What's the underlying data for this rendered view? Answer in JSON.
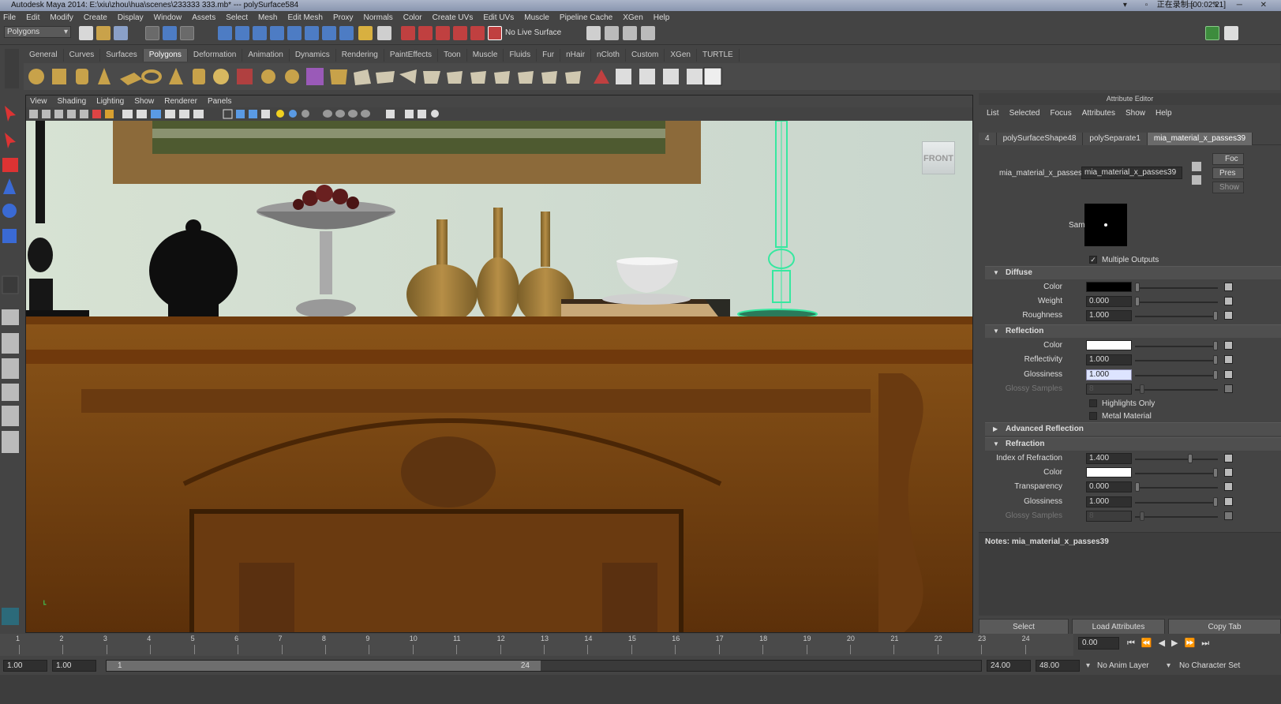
{
  "window": {
    "title": "Autodesk Maya 2014: E:\\xiu\\zhou\\hua\\scenes\\233333 333.mb*  ---  polySurface584",
    "recording": "正在录制 [00:02:21]"
  },
  "menubar": [
    "File",
    "Edit",
    "Modify",
    "Create",
    "Display",
    "Window",
    "Assets",
    "Select",
    "Mesh",
    "Edit Mesh",
    "Proxy",
    "Normals",
    "Color",
    "Create UVs",
    "Edit UVs",
    "Muscle",
    "Pipeline Cache",
    "XGen",
    "Help"
  ],
  "statusline": {
    "mode": "Polygons",
    "live_surface": "No Live Surface"
  },
  "shelf_tabs": [
    "General",
    "Curves",
    "Surfaces",
    "Polygons",
    "Deformation",
    "Animation",
    "Dynamics",
    "Rendering",
    "PaintEffects",
    "Toon",
    "Muscle",
    "Fluids",
    "Fur",
    "nHair",
    "nCloth",
    "Custom",
    "XGen",
    "TURTLE"
  ],
  "shelf_active": "Polygons",
  "viewport": {
    "menu": [
      "View",
      "Shading",
      "Lighting",
      "Show",
      "Renderer",
      "Panels"
    ],
    "view_cube": "FRONT"
  },
  "attribute_editor": {
    "title": "Attribute Editor",
    "menu": [
      "List",
      "Selected",
      "Focus",
      "Attributes",
      "Show",
      "Help"
    ],
    "tabs": [
      "4",
      "polySurfaceShape48",
      "polySeparate1",
      "mia_material_x_passes39"
    ],
    "active_tab": "mia_material_x_passes39",
    "node_label": "mia_material_x_passes:",
    "node_name": "mia_material_x_passes39",
    "side_buttons": [
      "Foc",
      "Pres",
      "Show"
    ],
    "sample_label": "Sample",
    "multiple_outputs": "Multiple Outputs",
    "diffuse": {
      "header": "Diffuse",
      "color_label": "Color",
      "color": "#000000",
      "weight_label": "Weight",
      "weight": "0.000",
      "roughness_label": "Roughness",
      "roughness": "1.000"
    },
    "reflection": {
      "header": "Reflection",
      "color_label": "Color",
      "color": "#ffffff",
      "reflectivity_label": "Reflectivity",
      "reflectivity": "1.000",
      "glossiness_label": "Glossiness",
      "glossiness": "1.000",
      "glossy_samples_label": "Glossy Samples",
      "glossy_samples": "8",
      "highlights_only": "Highlights Only",
      "metal_material": "Metal Material"
    },
    "advanced_reflection": {
      "header": "Advanced Reflection"
    },
    "refraction": {
      "header": "Refraction",
      "ior_label": "Index of Refraction",
      "ior": "1.400",
      "color_label": "Color",
      "color": "#ffffff",
      "transparency_label": "Transparency",
      "transparency": "0.000",
      "glossiness_label": "Glossiness",
      "glossiness": "1.000",
      "glossy_samples_label": "Glossy Samples",
      "glossy_samples": "8"
    },
    "notes": "Notes:  mia_material_x_passes39",
    "buttons": [
      "Select",
      "Load Attributes",
      "Copy Tab"
    ]
  },
  "timeslider": {
    "ticks": [
      "1",
      "2",
      "3",
      "4",
      "5",
      "6",
      "7",
      "8",
      "9",
      "10",
      "11",
      "12",
      "13",
      "14",
      "15",
      "16",
      "17",
      "18",
      "19",
      "20",
      "21",
      "22",
      "23",
      "24"
    ],
    "current_time": "0.00"
  },
  "rangebar": {
    "start": "1.00",
    "start2": "1.00",
    "range_start": "1",
    "range_end": "24",
    "end": "24.00",
    "end2": "48.00",
    "anim_layer": "No Anim Layer",
    "character_set": "No Character Set"
  },
  "colors": {
    "accent": "#5d5d5d",
    "selection_green": "#37e8a0",
    "wall": "#d2dccc",
    "wood": "#7a4412"
  }
}
